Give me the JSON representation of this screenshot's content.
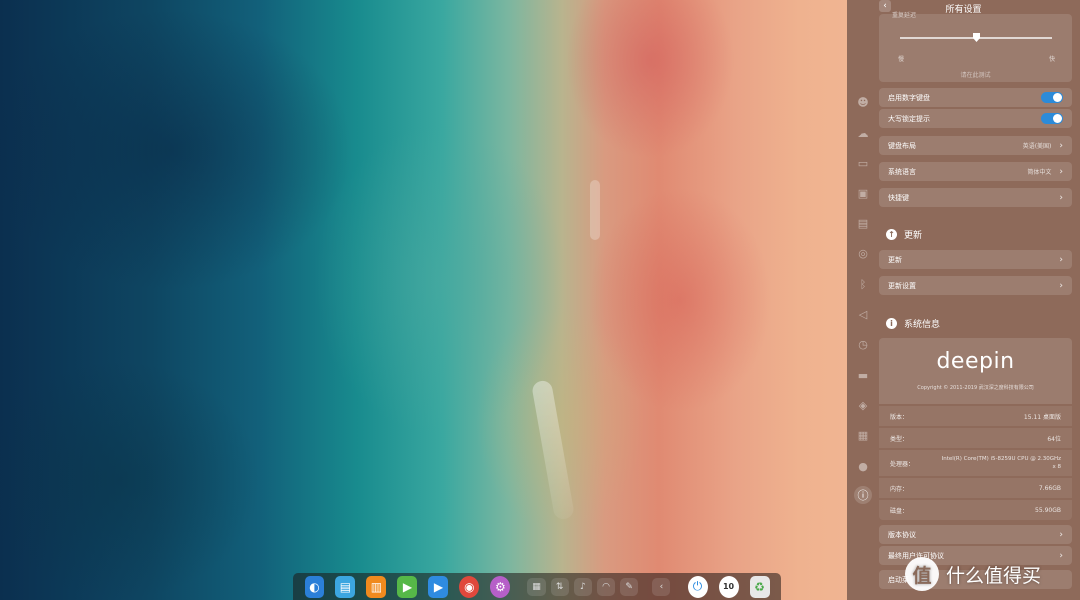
{
  "settings": {
    "title": "所有设置",
    "back_glyph": "‹",
    "speed_label_partial": "重复延迟",
    "slider": {
      "min_label": "慢",
      "max_label": "快",
      "value_fraction": 0.52
    },
    "test_hint": "请在此测试",
    "toggles": [
      {
        "label": "启用数字键盘",
        "on": true
      },
      {
        "label": "大写锁定提示",
        "on": true
      }
    ],
    "rows": [
      {
        "label": "键盘布局",
        "value": "英语(美国)"
      },
      {
        "label": "系统语言",
        "value": "简体中文"
      },
      {
        "label": "快捷键",
        "value": ""
      }
    ],
    "update": {
      "heading": "更新",
      "rows": [
        {
          "label": "更新"
        },
        {
          "label": "更新设置"
        }
      ]
    },
    "system_info": {
      "heading": "系统信息",
      "logo_text": "deepin",
      "copyright": "Copyright © 2011-2019 武汉深之度科技有限公司",
      "rows": [
        {
          "key": "版本：",
          "value": "15.11 桌面版"
        },
        {
          "key": "类型：",
          "value": "64位"
        },
        {
          "key": "处理器：",
          "value": "Intel(R) Core(TM) i5-8259U CPU @ 2.30GHz x 8"
        },
        {
          "key": "内存：",
          "value": "7.66GB"
        },
        {
          "key": "磁盘：",
          "value": "55.90GB"
        }
      ],
      "links": [
        {
          "label": "版本协议"
        },
        {
          "label": "最终用户许可协议"
        }
      ]
    },
    "partial_item": "启动菜"
  },
  "sidebar_icons": [
    "user-icon",
    "cloud-icon",
    "display-icon",
    "default-apps-icon",
    "personalization-icon",
    "network-icon",
    "bluetooth-icon",
    "sound-icon",
    "datetime-icon",
    "power-icon",
    "mouse-icon",
    "keyboard-icon",
    "update-icon",
    "info-icon"
  ],
  "dock": {
    "apps": [
      {
        "name": "launcher-icon",
        "glyph": "◐",
        "bg": "#2b7fd8"
      },
      {
        "name": "file-manager-icon",
        "glyph": "▤",
        "bg": "#3ca6e0"
      },
      {
        "name": "app-store-icon",
        "glyph": "▥",
        "bg": "#f08a1e"
      },
      {
        "name": "video-player-icon",
        "glyph": "▶",
        "bg": "#56b848"
      },
      {
        "name": "movie-icon",
        "glyph": "▶",
        "bg": "#2f8be0"
      },
      {
        "name": "chrome-icon",
        "glyph": "◉",
        "bg": "#e0483c"
      },
      {
        "name": "settings-icon",
        "glyph": "⚙",
        "bg": "#b65fc8"
      }
    ],
    "tray": [
      {
        "name": "keyboard-tray-icon",
        "glyph": "▦"
      },
      {
        "name": "usb-tray-icon",
        "glyph": "⇅"
      },
      {
        "name": "volume-tray-icon",
        "glyph": "♪"
      },
      {
        "name": "wifi-tray-icon",
        "glyph": "◠"
      },
      {
        "name": "pen-tray-icon",
        "glyph": "✎"
      },
      {
        "name": "collapse-tray-icon",
        "glyph": "‹"
      }
    ],
    "system": [
      {
        "name": "power-icon",
        "glyph": "⏻",
        "bg": "#ffffff",
        "fg": "#2b8be0"
      },
      {
        "name": "clock-icon",
        "glyph": "10",
        "bg": "#ffffff",
        "fg": "#333333"
      },
      {
        "name": "trash-icon",
        "glyph": "♻",
        "bg": "#e8e8e8",
        "fg": "#48a848"
      }
    ]
  },
  "watermark": {
    "logo": "值",
    "text": "什么值得买"
  }
}
